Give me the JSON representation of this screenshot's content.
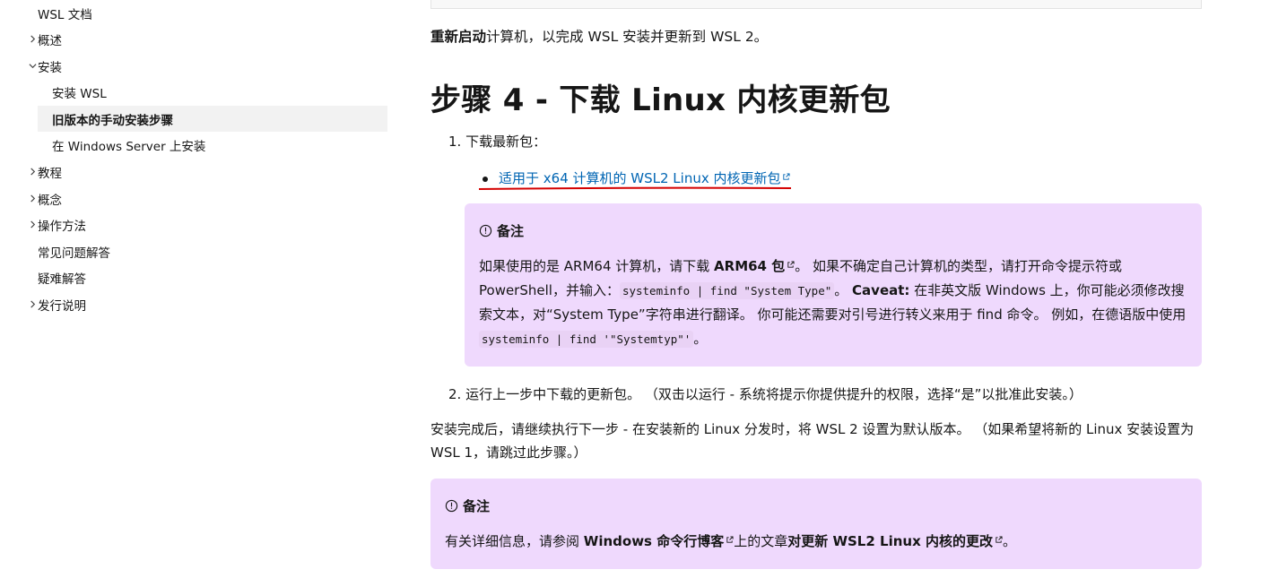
{
  "sidebar": {
    "items": [
      {
        "label": "WSL 文档",
        "chevron": "none"
      },
      {
        "label": "概述",
        "chevron": "right"
      },
      {
        "label": "安装",
        "chevron": "down"
      },
      {
        "label": "安装 WSL",
        "chevron": "none"
      },
      {
        "label": "旧版本的手动安装步骤",
        "chevron": "none",
        "active": true
      },
      {
        "label": "在 Windows Server 上安装",
        "chevron": "none"
      },
      {
        "label": "教程",
        "chevron": "right"
      },
      {
        "label": "概念",
        "chevron": "right"
      },
      {
        "label": "操作方法",
        "chevron": "right"
      },
      {
        "label": "常见问题解答",
        "chevron": "none"
      },
      {
        "label": "疑难解答",
        "chevron": "none"
      },
      {
        "label": "发行说明",
        "chevron": "right"
      }
    ]
  },
  "main": {
    "restart": {
      "bold": "重新启动",
      "rest": "计算机，以完成 WSL 安装并更新到 WSL 2。"
    },
    "heading": "步骤 4 - 下载 Linux 内核更新包",
    "list1": {
      "num": "1.",
      "text": "下载最新包："
    },
    "download_link": "适用于 x64 计算机的 WSL2 Linux 内核更新包",
    "note1": {
      "title": "备注",
      "t1": "如果使用的是 ARM64 计算机，请下载 ",
      "link_arm": "ARM64 包",
      "t2": "。 如果不确定自己计算机的类型，请打开命令提示符或 PowerShell，并输入：",
      "code1": "systeminfo | find \"System Type\"",
      "t3": "。 ",
      "caveat": "Caveat:",
      "t4": " 在非英文版 Windows 上，你可能必须修改搜索文本，对“System Type”字符串进行翻译。 你可能还需要对引号进行转义来用于 find 命令。 例如，在德语版中使用 ",
      "code2": "systeminfo | find '\"Systemtyp\"'",
      "t5": "。"
    },
    "list2": {
      "num": "2.",
      "text": "运行上一步中下载的更新包。 （双击以运行 - 系统将提示你提供提升的权限，选择“是”以批准此安装。）"
    },
    "para": "安装完成后，请继续执行下一步 - 在安装新的 Linux 分发时，将 WSL 2 设置为默认版本。 （如果希望将新的 Linux 安装设置为 WSL 1，请跳过此步骤。）",
    "note2": {
      "title": "备注",
      "t1": "有关详细信息，请参阅 ",
      "link_blog": "Windows 命令行博客",
      "t2": "上的文章",
      "link_article": "对更新 WSL2 Linux 内核的更改",
      "t3": "。"
    }
  },
  "colors": {
    "link": "#0065b3",
    "note_bg": "#efd9fd",
    "active_bg": "#f2f2f2",
    "annotation_red": "#d40000"
  }
}
